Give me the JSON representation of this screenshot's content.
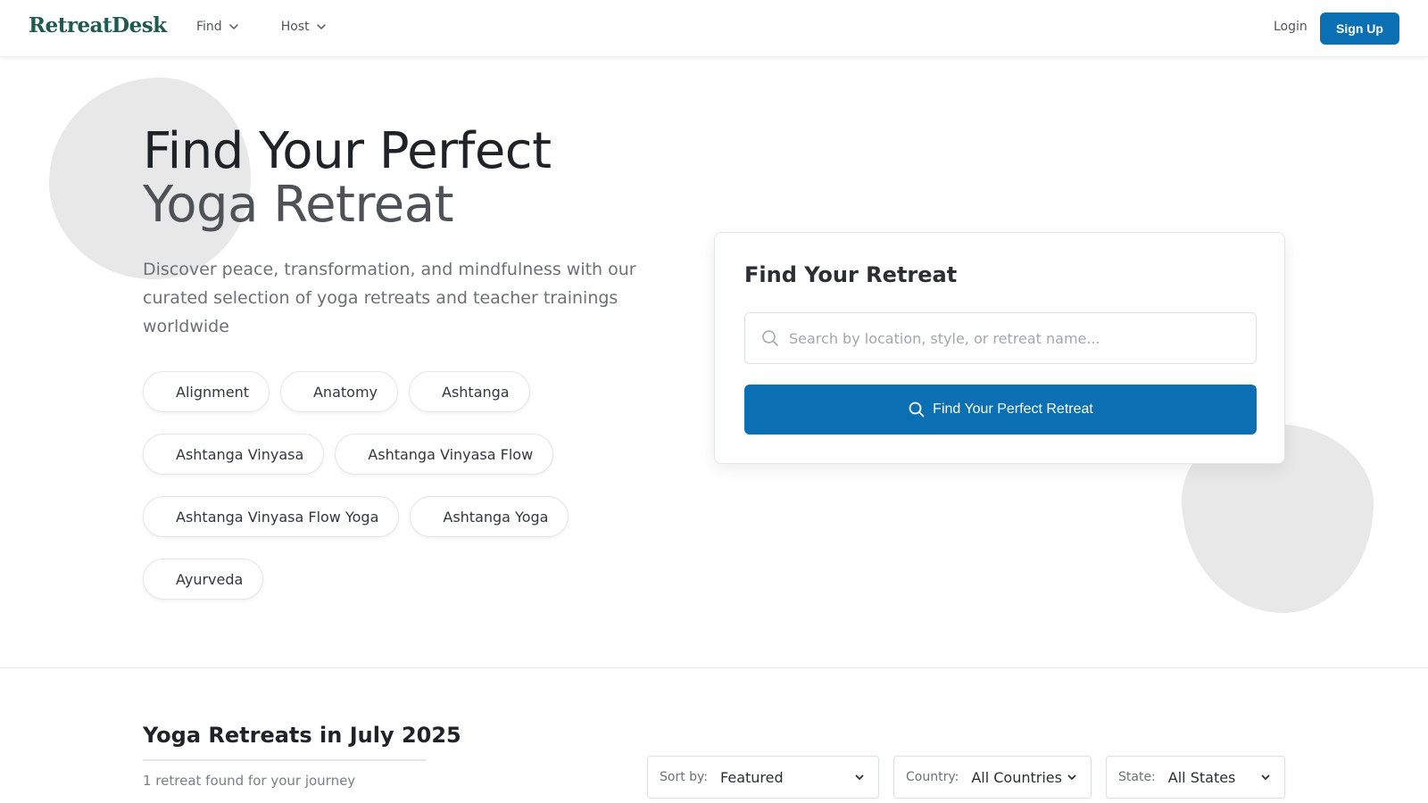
{
  "nav": {
    "logo": "RetreatDesk",
    "menu": [
      {
        "label": "Find",
        "icon": "chevron-down-icon"
      },
      {
        "label": "Host",
        "icon": "chevron-down-icon"
      }
    ],
    "login": "Login",
    "signup": "Sign Up"
  },
  "hero": {
    "title_line1": "Find Your Perfect",
    "title_line2": "Yoga Retreat",
    "description": "Discover peace, transformation, and mindfulness with our curated selection of yoga retreats and teacher trainings worldwide",
    "tags": [
      "Alignment",
      "Anatomy",
      "Ashtanga",
      "Ashtanga Vinyasa",
      "Ashtanga Vinyasa Flow",
      "Ashtanga Vinyasa Flow Yoga",
      "Ashtanga Yoga",
      "Ayurveda"
    ]
  },
  "search_card": {
    "title": "Find Your Retreat",
    "placeholder": "Search by location, style, or retreat name...",
    "value": "",
    "button": "Find Your Perfect Retreat",
    "icon": "search-icon"
  },
  "listing": {
    "title": "Yoga Retreats in July 2025",
    "count_text": "1 retreat found for your journey",
    "filters": {
      "sort": {
        "label": "Sort by:",
        "value": "Featured"
      },
      "country": {
        "label": "Country:",
        "value": "All Countries"
      },
      "state": {
        "label": "State:",
        "value": "All States"
      }
    }
  },
  "colors": {
    "brand": "#1e5a50",
    "primary": "#0a6fb3",
    "blob": "#e8e8e8"
  }
}
